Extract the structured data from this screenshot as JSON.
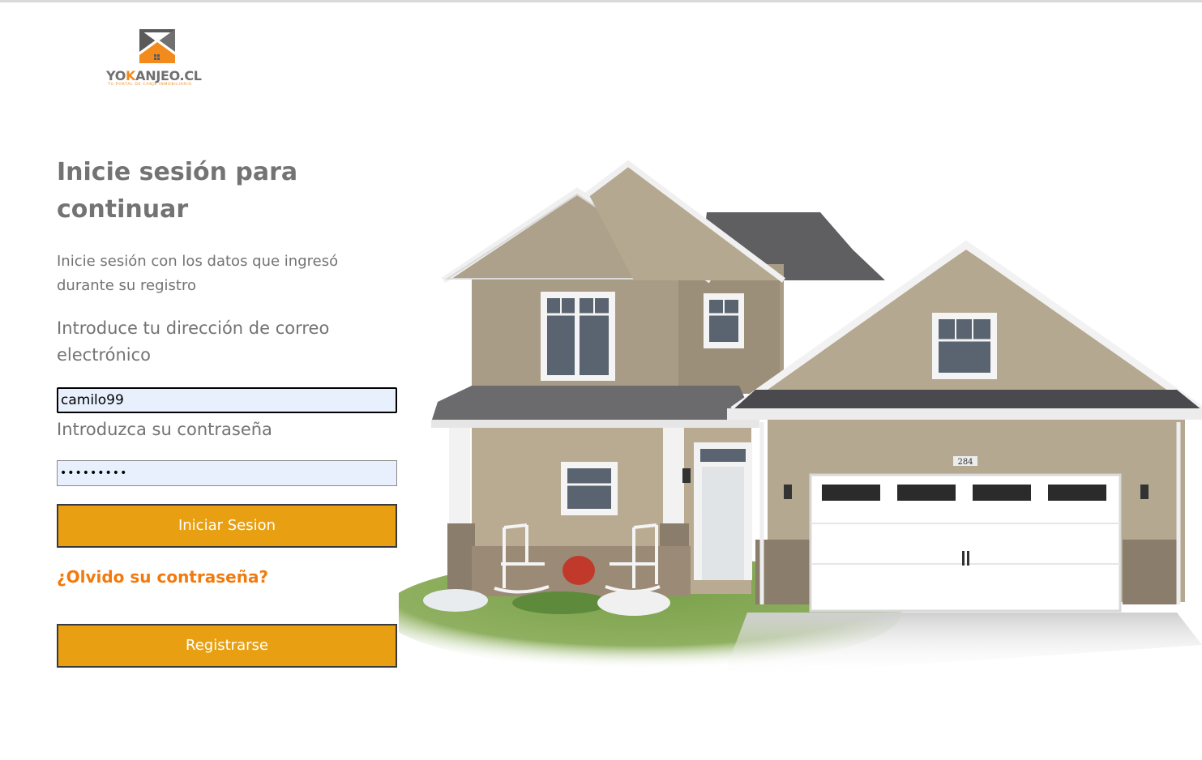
{
  "logo": {
    "brand_prefix": "YO",
    "brand_k": "K",
    "brand_suffix": "ANJEO.CL",
    "tagline": "TU PORTAL DE CANJE INMOBILIARIO"
  },
  "login": {
    "heading": "Inicie sesión para continuar",
    "subtitle": "Inicie sesión con los datos que ingresó durante su registro",
    "email_label": "Introduce tu dirección de correo electrónico",
    "email_value": "camilo99",
    "password_label": "Introduzca su contraseña",
    "password_value": "camilo123",
    "login_button": "Iniciar Sesion",
    "forgot_link": "¿Olvido su contraseña?",
    "register_button": "Registrarse"
  },
  "house": {
    "address_number": "284"
  },
  "colors": {
    "accent": "#e8a012",
    "link": "#f27a0c",
    "text": "#737373",
    "input_bg": "#e8f0fe"
  }
}
